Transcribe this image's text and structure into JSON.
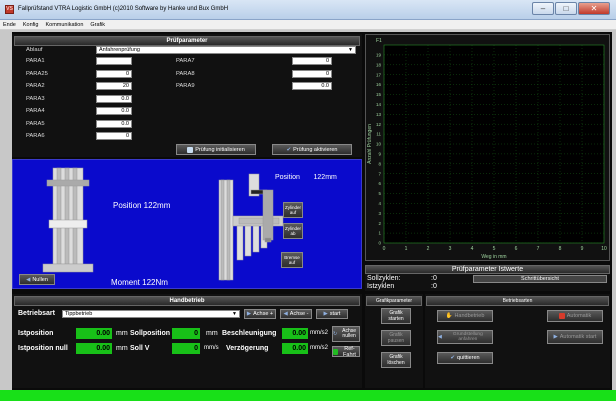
{
  "window": {
    "title": "Fallprüfstand VTRA Logistic GmbH    (c)2010 Software by Hanke und Bux GmbH",
    "app_icon": "VS"
  },
  "menu": [
    "Ende",
    "Konfig",
    "Kommunikation",
    "Grafik"
  ],
  "pruef": {
    "header": "Prüfparameter",
    "ablauf_label": "Ablauf",
    "ablauf_value": "Anfahrenprüfung",
    "left": [
      {
        "label": "PARA1",
        "value": ""
      },
      {
        "label": "PARA25",
        "value": "0"
      },
      {
        "label": "PARA2",
        "value": "20"
      },
      {
        "label": "PARA3",
        "value": "0.0"
      },
      {
        "label": "PARA4",
        "value": "0.0"
      },
      {
        "label": "PARA5",
        "value": "0.0"
      },
      {
        "label": "PARA6",
        "value": "0"
      }
    ],
    "right": [
      {
        "label": "PARA7",
        "value": "0"
      },
      {
        "label": "PARA8",
        "value": "0"
      },
      {
        "label": "PARA9",
        "value": "0.0"
      }
    ],
    "btn_init": "Prüfung initialisieren",
    "btn_activate": "Prüfung aktivieren"
  },
  "machine": {
    "position_main": "Position   122mm",
    "position_right": "Position       122mm",
    "moment": "Moment  122Nm",
    "btn_nullen": "Nullen",
    "btn_zyl_auf": "Zylinder auf",
    "btn_zyl_ab": "Zylinder ab",
    "btn_bremse": "Bremse auf"
  },
  "chart_data": {
    "type": "line",
    "title": "",
    "xlabel": "Weg in mm",
    "ylabel": "Anzahl Prüfungen",
    "xlim": [
      0,
      10
    ],
    "ylim": [
      0,
      20
    ],
    "x_ticks": [
      "0",
      "1",
      "2",
      "3",
      "4",
      "5",
      "6",
      "7",
      "8",
      "9",
      "10"
    ],
    "y_ticks": [
      "0",
      "1",
      "2",
      "3",
      "4",
      "5",
      "6",
      "7",
      "8",
      "9",
      "10",
      "11",
      "12",
      "13",
      "14",
      "15",
      "16",
      "17",
      "18",
      "19"
    ],
    "y_top_label": "F1",
    "series": [],
    "grid": true
  },
  "ist": {
    "header": "Prüfparameter Istwerte",
    "soll_label": "Sollzyklen:",
    "soll_value": ":0",
    "ist_label": "Istzyklen",
    "ist_value": ":0",
    "btn_schritt": "Schrittübersicht"
  },
  "hand": {
    "header": "Handbetrieb",
    "betriebsart_label": "Betriebsart",
    "betriebsart_value": "Tippbetrieb",
    "btn_achse_plus": "Achse +",
    "btn_achse_minus": "Achse -",
    "btn_start": "start",
    "istpos_label": "Istposition",
    "istpos_value": "0.00",
    "mm1": "mm",
    "sollpos_label": "Sollposition",
    "sollpos_value": "0",
    "mm2": "mm",
    "beschl_label": "Beschleunigung",
    "beschl_value": "0.00",
    "unit_beschl": "mm/s2",
    "btn_achse_nullen": "Achse nullen",
    "istnull_label": "Istposition null",
    "istnull_value": "0.00",
    "mm3": "mm",
    "sollv_label": "Soll V",
    "sollv_value": "0",
    "unit_v": "mm/s",
    "verz_label": "Verzögerung",
    "verz_value": "0.00",
    "unit_verz": "mm/s2",
    "btn_ref": "Ref-Fahrt"
  },
  "grafik": {
    "header": "Grafikparameter",
    "btn_starten": "Grafik starten",
    "btn_pause": "Grafik pausen",
    "btn_loeschen": "Grafik löschen"
  },
  "betrieb": {
    "header": "Betriebsarten",
    "btn_hand": "Handbetrieb",
    "btn_auto": "Automatik",
    "btn_grund": "Grundstellung anfahren",
    "btn_auto_start": "Automatik start",
    "btn_quit": "quittieren"
  },
  "colors": {
    "panel_green": "#18c018",
    "machine_blue": "#0a0acc",
    "chart_green": "#1a6e1a",
    "status_green": "#18e018"
  }
}
